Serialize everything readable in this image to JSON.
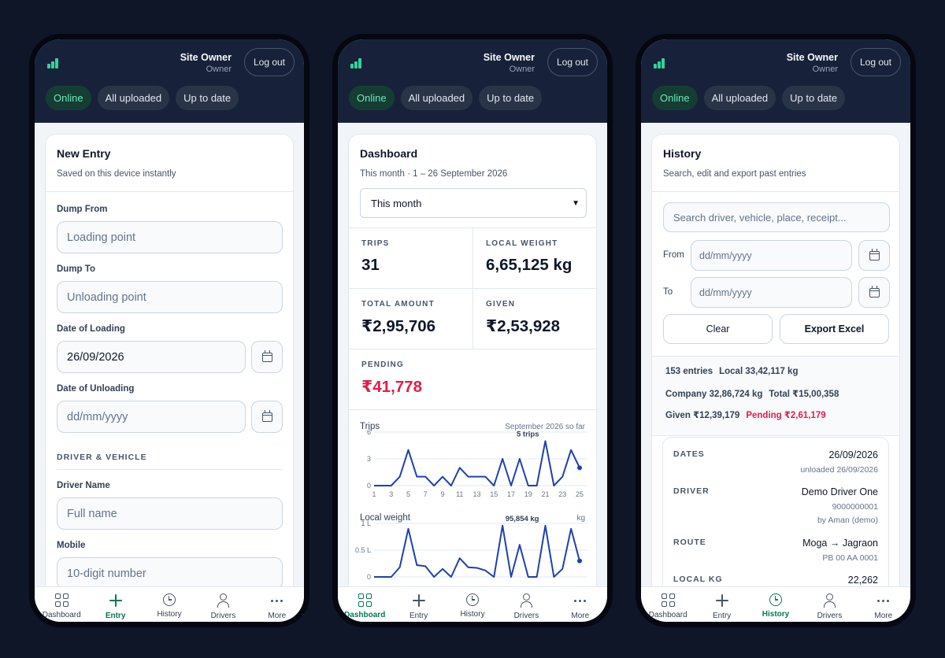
{
  "header": {
    "user_name": "Site Owner",
    "user_role": "Owner",
    "logout_label": "Log out",
    "status_chips": [
      "Online",
      "All uploaded",
      "Up to date"
    ]
  },
  "bottom_nav": [
    {
      "label": "Dashboard",
      "icon": "grid-icon"
    },
    {
      "label": "Entry",
      "icon": "plus-icon"
    },
    {
      "label": "History",
      "icon": "clock-icon"
    },
    {
      "label": "Drivers",
      "icon": "user-icon"
    },
    {
      "label": "More",
      "icon": "more-icon"
    }
  ],
  "colors": {
    "accent": "#047857",
    "online": "#6ee7b7",
    "pending": "#e11d48",
    "header": "#17223a",
    "chart": "#1e40af"
  },
  "entry": {
    "title": "New Entry",
    "subtitle": "Saved on this device instantly",
    "dump_from_label": "Dump From",
    "dump_from_placeholder": "Loading point",
    "dump_to_label": "Dump To",
    "dump_to_placeholder": "Unloading point",
    "loading_date_label": "Date of Loading",
    "loading_date_value": "26/09/2026",
    "unloading_date_label": "Date of Unloading",
    "unloading_date_placeholder": "dd/mm/yyyy",
    "section_driver": "DRIVER & VEHICLE",
    "driver_name_label": "Driver Name",
    "driver_name_placeholder": "Full name",
    "mobile_label": "Mobile",
    "mobile_placeholder": "10-digit number"
  },
  "dashboard": {
    "title": "Dashboard",
    "subtitle": "This month · 1 – 26 September 2026",
    "period_selected": "This month",
    "kpis": {
      "trips": {
        "label": "TRIPS",
        "value": "31"
      },
      "local_weight": {
        "label": "LOCAL WEIGHT",
        "value": "6,65,125 kg"
      },
      "total_amount": {
        "label": "TOTAL AMOUNT",
        "value": "₹2,95,706"
      },
      "given": {
        "label": "GIVEN",
        "value": "₹2,53,928"
      },
      "pending": {
        "label": "PENDING",
        "value": "₹41,778"
      }
    },
    "trips_chart_title": "Trips",
    "trips_chart_note": "September 2026 so far",
    "trips_peak_label": "5 trips",
    "weight_chart_title": "Local weight",
    "weight_chart_unit": "kg",
    "weight_peak_label": "95,854 kg"
  },
  "chart_data": [
    {
      "type": "line",
      "title": "Trips",
      "subtitle": "September 2026 so far",
      "x": [
        1,
        2,
        3,
        4,
        5,
        6,
        7,
        8,
        9,
        10,
        11,
        12,
        13,
        14,
        15,
        16,
        17,
        18,
        19,
        20,
        21,
        22,
        23,
        24,
        25,
        26
      ],
      "x_tick_labels": [
        "1",
        "3",
        "5",
        "7",
        "9",
        "11",
        "13",
        "15",
        "17",
        "19",
        "21",
        "23",
        "25"
      ],
      "y_tick_labels": [
        "6",
        "3",
        "0"
      ],
      "ylim": [
        0,
        6
      ],
      "series": [
        {
          "values": [
            0,
            0,
            0,
            1,
            4,
            1,
            1,
            0,
            1,
            0,
            2,
            1,
            1,
            1,
            0,
            3,
            0,
            3,
            0,
            0,
            5,
            0,
            1,
            4,
            2
          ]
        }
      ],
      "annotation": "5 trips",
      "grid": true
    },
    {
      "type": "line",
      "title": "Local weight",
      "ylabel": "kg",
      "x": [
        1,
        2,
        3,
        4,
        5,
        6,
        7,
        8,
        9,
        10,
        11,
        12,
        13,
        14,
        15,
        16,
        17,
        18,
        19,
        20,
        21,
        22,
        23,
        24,
        25,
        26
      ],
      "y_tick_labels": [
        "1 L",
        "0.5 L",
        "0"
      ],
      "ylim": [
        0,
        100000
      ],
      "series": [
        {
          "values": [
            0,
            0,
            0,
            18000,
            90000,
            22000,
            20000,
            0,
            15000,
            0,
            35000,
            18000,
            17000,
            12000,
            0,
            95854,
            0,
            60000,
            0,
            0,
            95854,
            0,
            15000,
            90000,
            30000
          ]
        }
      ],
      "annotation": "95,854 kg",
      "grid": true
    }
  ],
  "history": {
    "title": "History",
    "subtitle": "Search, edit and export past entries",
    "search_placeholder": "Search driver, vehicle, place, receipt...",
    "from_label": "From",
    "to_label": "To",
    "date_placeholder": "dd/mm/yyyy",
    "clear_label": "Clear",
    "export_label": "Export Excel",
    "summary": {
      "entries": "153 entries",
      "local": "Local 33,42,117 kg",
      "company": "Company 32,86,724 kg",
      "total": "Total ₹15,00,358",
      "given": "Given ₹12,39,179",
      "pending": "Pending ₹2,61,179"
    },
    "entry": {
      "dates_label": "DATES",
      "date": "26/09/2026",
      "unloaded": "unloaded 26/09/2026",
      "driver_label": "DRIVER",
      "driver_name": "Demo Driver One",
      "driver_phone": "9000000001",
      "driver_by": "by Aman (demo)",
      "route_label": "ROUTE",
      "route": "Moga → Jagraon",
      "vehicle": "PB 00 AA 0001",
      "local_kg_label": "LOCAL KG",
      "local_kg": "22,262"
    }
  }
}
